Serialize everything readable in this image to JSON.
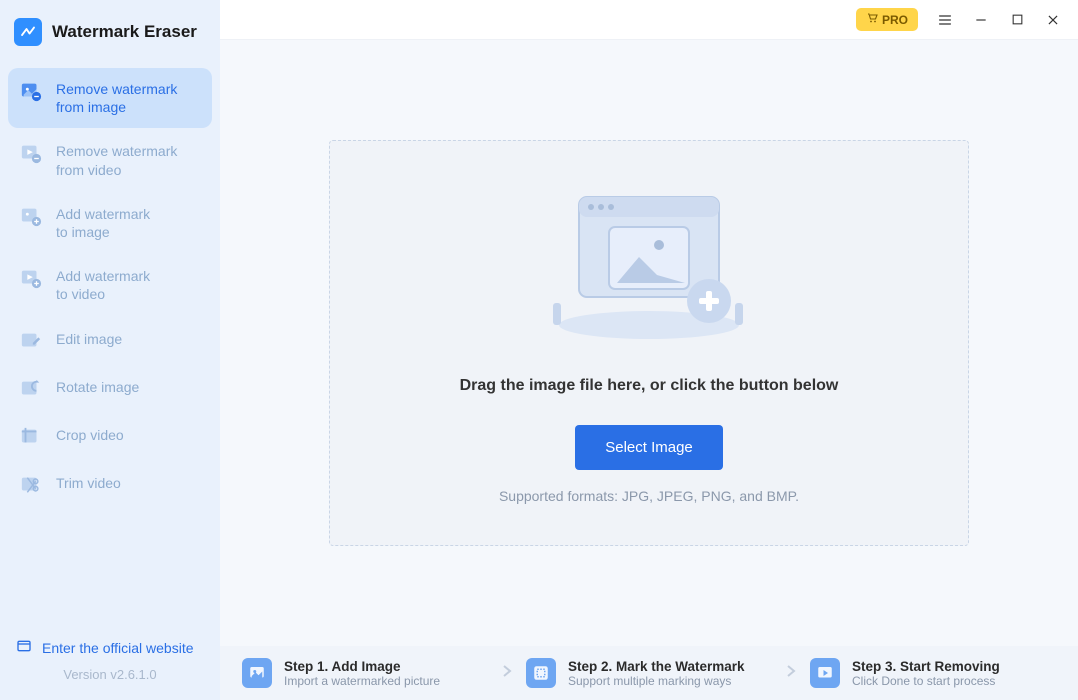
{
  "app": {
    "title": "Watermark Eraser",
    "version": "Version v2.6.1.0",
    "official_link": "Enter the official website"
  },
  "topbar": {
    "pro_label": "PRO"
  },
  "sidebar": {
    "items": [
      {
        "label": "Remove watermark\nfrom image"
      },
      {
        "label": "Remove watermark\nfrom video"
      },
      {
        "label": "Add watermark\nto image"
      },
      {
        "label": "Add watermark\nto video"
      },
      {
        "label": "Edit image"
      },
      {
        "label": "Rotate image"
      },
      {
        "label": "Crop video"
      },
      {
        "label": "Trim video"
      }
    ]
  },
  "dropzone": {
    "prompt": "Drag the image file here, or click the button below",
    "button": "Select Image",
    "formats": "Supported formats: JPG, JPEG, PNG, and BMP."
  },
  "steps": [
    {
      "title": "Step 1. Add Image",
      "sub": "Import a watermarked picture"
    },
    {
      "title": "Step 2. Mark the Watermark",
      "sub": "Support multiple marking ways"
    },
    {
      "title": "Step 3. Start Removing",
      "sub": "Click Done to start process"
    }
  ]
}
